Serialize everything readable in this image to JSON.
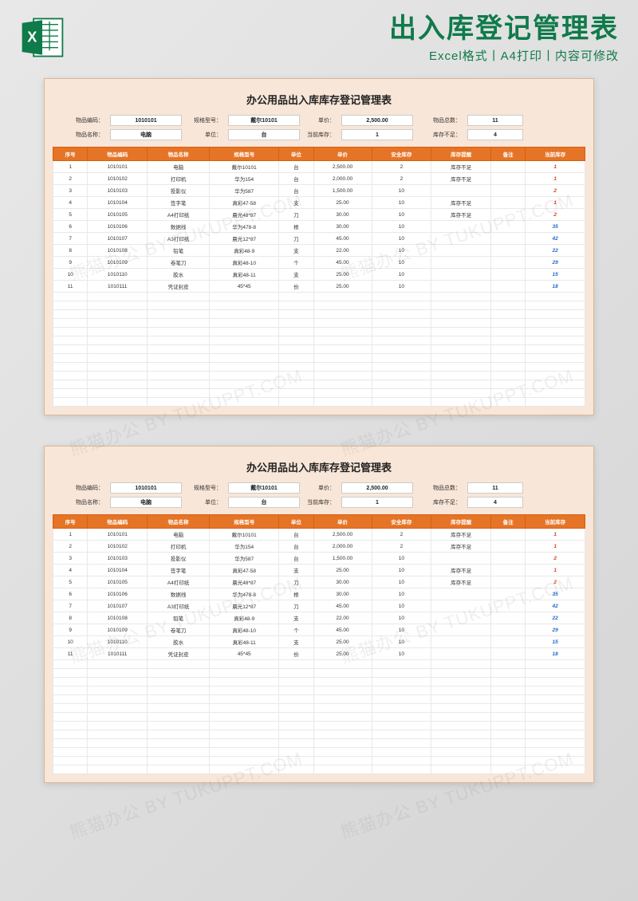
{
  "header": {
    "title": "出入库登记管理表",
    "subtitle": "Excel格式丨A4打印丨内容可修改"
  },
  "doc": {
    "title": "办公用品出入库库存登记管理表",
    "info_labels": {
      "code": "物品编码：",
      "spec": "规格型号：",
      "price": "单价：",
      "total": "物品总数：",
      "name": "物品名称：",
      "unit": "单位：",
      "curstock": "当前库存：",
      "lowstock": "库存不足："
    },
    "info_values": {
      "code": "1010101",
      "spec": "戴尔10101",
      "price": "2,500.00",
      "total": "11",
      "name": "电脑",
      "unit": "台",
      "curstock": "1",
      "lowstock": "4"
    },
    "columns": [
      "序号",
      "物品编码",
      "物品名称",
      "规格型号",
      "单位",
      "单价",
      "安全库存",
      "库存提醒",
      "备注",
      "当前库存"
    ],
    "rows": [
      {
        "no": "1",
        "code": "1010101",
        "name": "电脑",
        "spec": "戴尔10101",
        "unit": "台",
        "price": "2,500.00",
        "safe": "2",
        "warn": "库存不足",
        "note": "",
        "stock": "1",
        "low": true
      },
      {
        "no": "2",
        "code": "1010102",
        "name": "打印机",
        "spec": "华为154",
        "unit": "台",
        "price": "2,000.00",
        "safe": "2",
        "warn": "库存不足",
        "note": "",
        "stock": "1",
        "low": true
      },
      {
        "no": "3",
        "code": "1010103",
        "name": "投影仪",
        "spec": "华为587",
        "unit": "台",
        "price": "1,500.00",
        "safe": "10",
        "warn": "",
        "note": "",
        "stock": "2",
        "low": true
      },
      {
        "no": "4",
        "code": "1010104",
        "name": "签字笔",
        "spec": "真彩47-58",
        "unit": "支",
        "price": "25.00",
        "safe": "10",
        "warn": "库存不足",
        "note": "",
        "stock": "1",
        "low": true
      },
      {
        "no": "5",
        "code": "1010105",
        "name": "A4打印纸",
        "spec": "晨光48*87",
        "unit": "刀",
        "price": "30.00",
        "safe": "10",
        "warn": "库存不足",
        "note": "",
        "stock": "2",
        "low": true
      },
      {
        "no": "6",
        "code": "1010106",
        "name": "数据线",
        "spec": "华为478-8",
        "unit": "根",
        "price": "30.00",
        "safe": "10",
        "warn": "",
        "note": "",
        "stock": "35",
        "low": false
      },
      {
        "no": "7",
        "code": "1010107",
        "name": "A3打印纸",
        "spec": "晨光12*87",
        "unit": "刀",
        "price": "45.00",
        "safe": "10",
        "warn": "",
        "note": "",
        "stock": "42",
        "low": false
      },
      {
        "no": "8",
        "code": "1010108",
        "name": "铅笔",
        "spec": "真彩48-9",
        "unit": "支",
        "price": "22.00",
        "safe": "10",
        "warn": "",
        "note": "",
        "stock": "22",
        "low": false
      },
      {
        "no": "9",
        "code": "1010109",
        "name": "卷笔刀",
        "spec": "真彩48-10",
        "unit": "个",
        "price": "45.00",
        "safe": "10",
        "warn": "",
        "note": "",
        "stock": "29",
        "low": false
      },
      {
        "no": "10",
        "code": "1010110",
        "name": "胶水",
        "spec": "真彩48-11",
        "unit": "支",
        "price": "25.00",
        "safe": "10",
        "warn": "",
        "note": "",
        "stock": "15",
        "low": false
      },
      {
        "no": "11",
        "code": "1010111",
        "name": "凭证封皮",
        "spec": "45*45",
        "unit": "份",
        "price": "25.00",
        "safe": "10",
        "warn": "",
        "note": "",
        "stock": "18",
        "low": false
      }
    ],
    "empty_rows": 13
  },
  "watermark": "熊猫办公 BY TUKUPPT.COM"
}
